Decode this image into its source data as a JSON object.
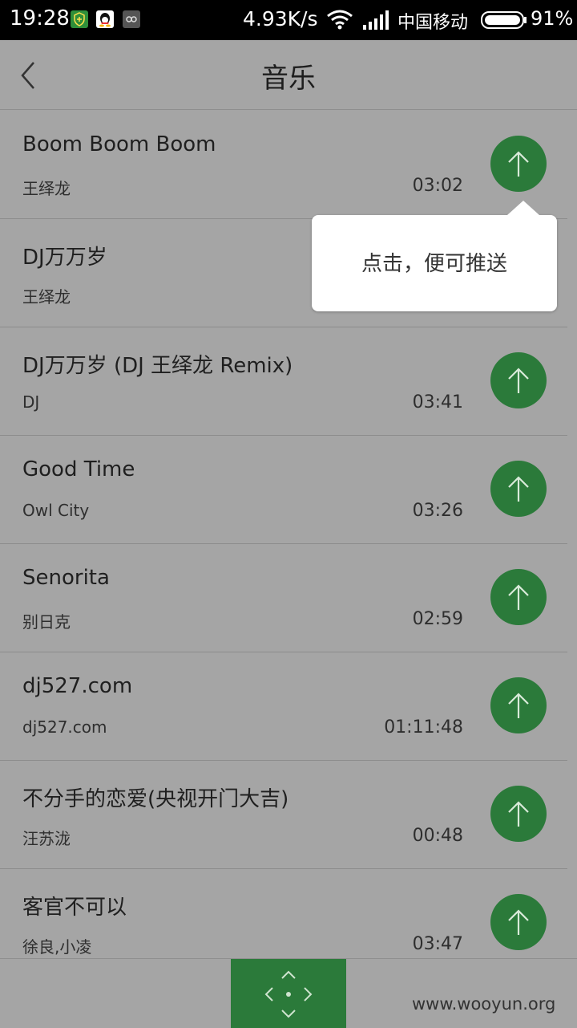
{
  "status_bar": {
    "time": "19:28",
    "net_speed": "4.93K/s",
    "carrier": "中国移动",
    "battery": "91%",
    "app_icons": [
      "shield-icon",
      "qq-penguin-icon",
      "gamepad-icon"
    ]
  },
  "header": {
    "title": "音乐",
    "back_icon": "chevron-left-icon"
  },
  "tooltip": {
    "text": "点击，便可推送"
  },
  "songs": [
    {
      "title": "Boom Boom Boom",
      "artist": "王绎龙",
      "duration": "03:02"
    },
    {
      "title": "DJ万万岁",
      "artist": "王绎龙",
      "duration": ""
    },
    {
      "title": "DJ万万岁 (DJ 王绎龙 Remix)",
      "artist": "DJ",
      "duration": "03:41"
    },
    {
      "title": "Good Time",
      "artist": "Owl City",
      "duration": "03:26"
    },
    {
      "title": "Senorita",
      "artist": "别日克",
      "duration": "02:59"
    },
    {
      "title": "dj527.com",
      "artist": "dj527.com",
      "duration": "01:11:48"
    },
    {
      "title": "不分手的恋爱(央视开门大吉)",
      "artist": "汪苏泷",
      "duration": "00:48"
    },
    {
      "title": "客官不可以",
      "artist": "徐良,小凌",
      "duration": "03:47"
    }
  ],
  "push_icon": "arrow-up-icon",
  "bottom": {
    "pad_icon": "dpad-icon",
    "watermark": "www.wooyun.org"
  },
  "colors": {
    "accent_green": "#2b7a3a",
    "dim_background": "#a5a5a5"
  }
}
